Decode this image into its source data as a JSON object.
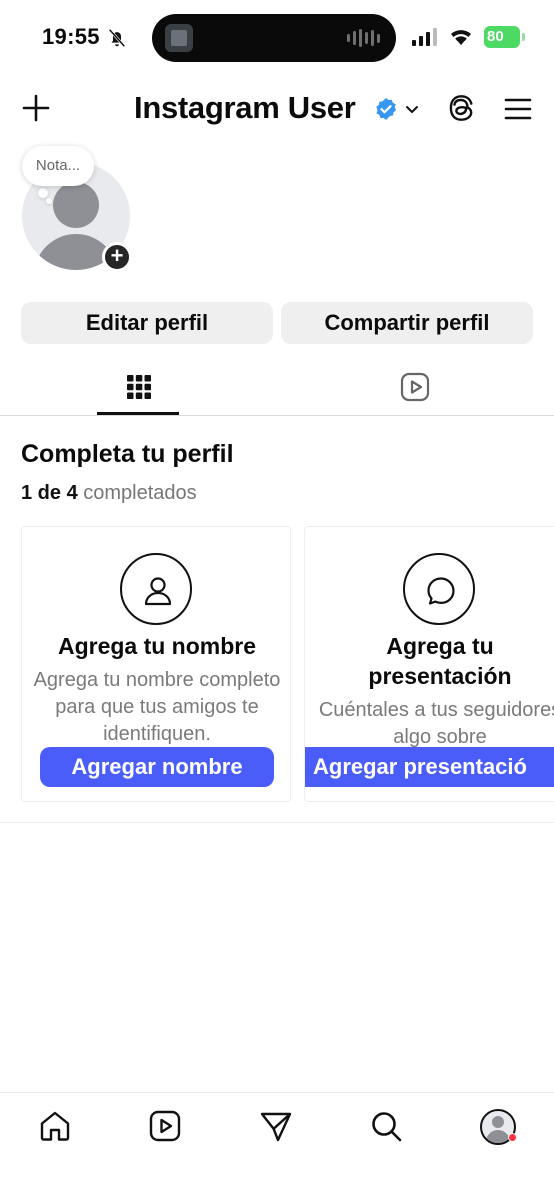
{
  "status_bar": {
    "time": "19:55",
    "battery": "80"
  },
  "header": {
    "username": "Instagram User"
  },
  "profile": {
    "note_placeholder": "Nota..."
  },
  "actions": {
    "edit_profile": "Editar perfil",
    "share_profile": "Compartir perfil"
  },
  "complete_profile": {
    "title": "Completa tu perfil",
    "progress_count": "1 de 4",
    "progress_label": "completados",
    "cards": [
      {
        "title": "Agrega tu nombre",
        "description": "Agrega tu nombre completo para que tus amigos te identifiquen.",
        "button": "Agregar nombre"
      },
      {
        "title": "Agrega tu presentación",
        "description": "Cuéntales a tus seguidores algo sobre",
        "button": "Agregar presentació"
      }
    ]
  },
  "colors": {
    "accent_button": "#4a5df9",
    "verified_badge": "#3897f0",
    "battery": "#4cd964",
    "notification_dot": "#ff3040"
  },
  "icons": {
    "header": [
      "plus-icon",
      "verified-icon",
      "chevron-down-icon",
      "threads-icon",
      "menu-icon"
    ],
    "tabs": [
      "grid-icon",
      "reels-icon"
    ],
    "bottom_nav": [
      "home-icon",
      "reels-icon",
      "send-icon",
      "search-icon",
      "profile-avatar"
    ]
  }
}
